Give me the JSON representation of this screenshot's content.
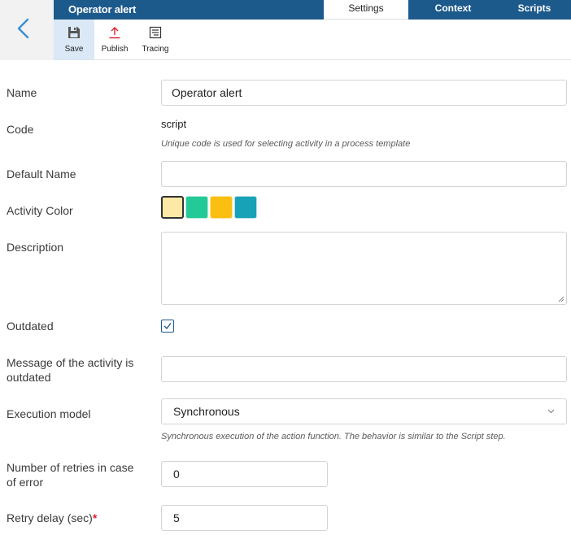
{
  "header": {
    "title": "Operator alert",
    "tabs": [
      {
        "label": "Settings",
        "active": true
      },
      {
        "label": "Context",
        "active": false
      },
      {
        "label": "Scripts",
        "active": false
      }
    ]
  },
  "toolbar": {
    "save_label": "Save",
    "publish_label": "Publish",
    "tracing_label": "Tracing"
  },
  "form": {
    "name": {
      "label": "Name",
      "value": "Operator alert"
    },
    "code": {
      "label": "Code",
      "value": "script",
      "hint": "Unique code is used for selecting activity in a process template"
    },
    "default_name": {
      "label": "Default Name",
      "value": ""
    },
    "activity_color": {
      "label": "Activity Color",
      "colors": [
        "#fde8a5",
        "#23c997",
        "#fbbf12",
        "#17a2b8"
      ],
      "selected_index": 0
    },
    "description": {
      "label": "Description",
      "value": ""
    },
    "outdated": {
      "label": "Outdated",
      "checked": true
    },
    "outdated_message": {
      "label_line1": "Message of the activity is",
      "label_line2": "outdated",
      "value": ""
    },
    "execution_model": {
      "label": "Execution model",
      "value": "Synchronous",
      "hint": "Synchronous execution of the action function. The behavior is similar to the Script step."
    },
    "retries": {
      "label_line1": "Number of retries in case",
      "label_line2": "of error",
      "value": "0"
    },
    "retry_delay": {
      "label": "Retry delay (sec)",
      "required_mark": "*",
      "value": "5"
    }
  },
  "colors": {
    "header": "#1d5a8c",
    "save_active_bg": "#dbe8f5",
    "accent": "#3a8fd6",
    "required": "#d9212b"
  }
}
